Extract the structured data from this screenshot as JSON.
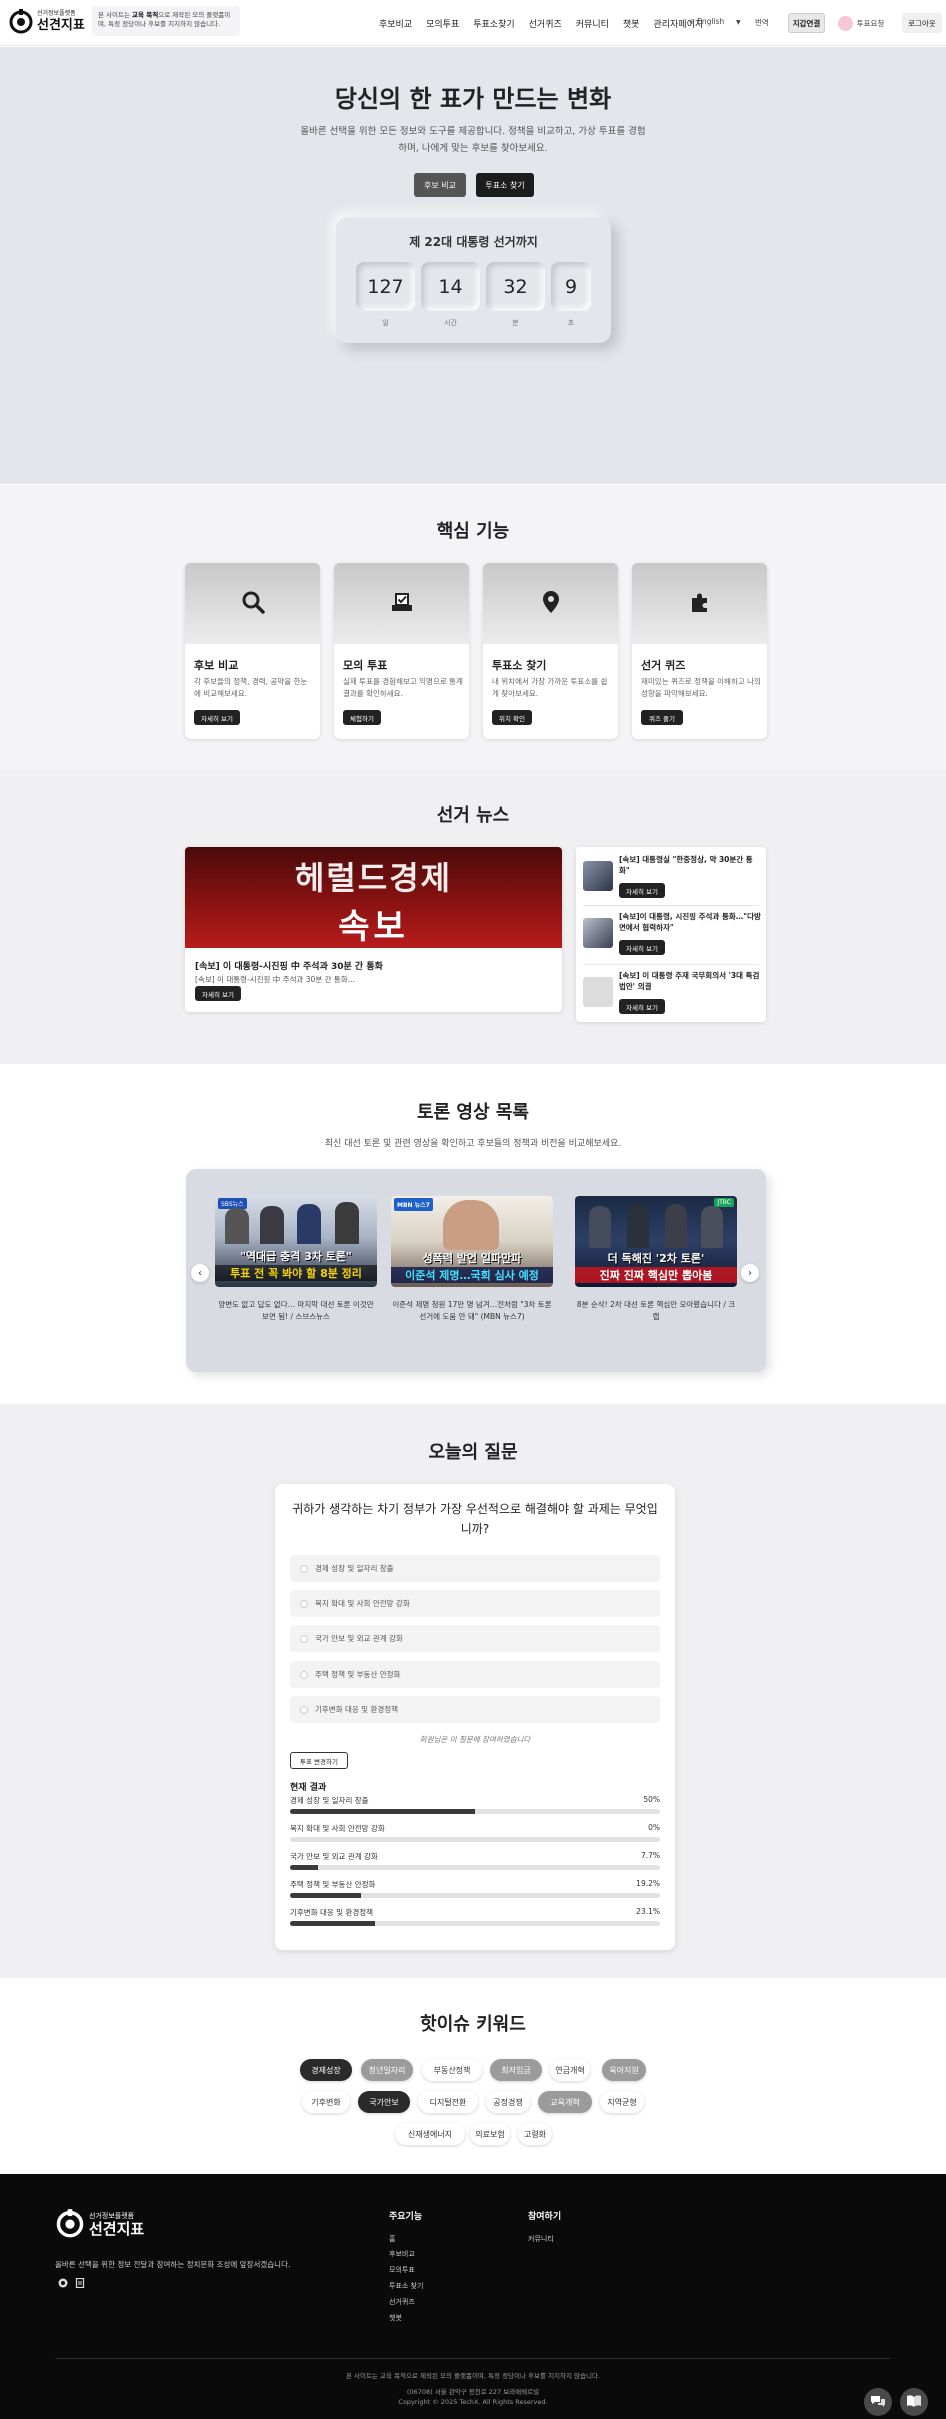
{
  "header": {
    "logo_sub": "선거정보플랫폼",
    "logo_main": "선견지표",
    "notice_pre": "본 사이트는 ",
    "notice_bold": "교육 목적",
    "notice_post": "으로 제작된 모의 플랫폼이며, 특정 정당이나 후보를 지지하지 않습니다.",
    "nav": [
      "후보비교",
      "모의투표",
      "투표소찾기",
      "선거퀴즈",
      "커뮤니티",
      "챗봇",
      "관리자페이지"
    ],
    "lang": "English",
    "translate": "번역",
    "btn_gray": "지갑연결",
    "btn_vote": "투표요청",
    "btn_login": "로그아웃"
  },
  "hero": {
    "title": "당신의 한 표가 만드는 변화",
    "desc": "올바른 선택을 위한 모든 정보와 도구를 제공합니다. 정책을 비교하고, 가상 투표를 경험하며, 나에게 맞는 후보를 찾아보세요.",
    "btn_compare": "후보 비교",
    "btn_find": "투표소 찾기",
    "countdown_title": "제 22대 대통령 선거까지",
    "countdown": [
      {
        "value": "127",
        "label": "일"
      },
      {
        "value": "14",
        "label": "시간"
      },
      {
        "value": "32",
        "label": "분"
      },
      {
        "value": "9",
        "label": "초"
      }
    ]
  },
  "features": {
    "title": "핵심 기능",
    "items": [
      {
        "icon": "search-icon",
        "title": "후보 비교",
        "desc": "각 후보들의 정책, 경력, 공약을 한눈에 비교해보세요.",
        "btn": "자세히 보기"
      },
      {
        "icon": "ballot-check-icon",
        "title": "모의 투표",
        "desc": "실제 투표를 경험해보고 익명으로 통계 결과를 확인하세요.",
        "btn": "체험하기"
      },
      {
        "icon": "map-pin-icon",
        "title": "투표소 찾기",
        "desc": "내 위치에서 가장 가까운 투표소를 쉽게 찾아보세요.",
        "btn": "위치 확인"
      },
      {
        "icon": "puzzle-icon",
        "title": "선거 퀴즈",
        "desc": "재미있는 퀴즈로 정책을 이해하고 나의 성향을 파악해보세요.",
        "btn": "퀴즈 풀기"
      }
    ]
  },
  "news": {
    "title": "선거 뉴스",
    "main": {
      "img_line1": "헤럴드경제",
      "img_line2": "속보",
      "title": "[속보] 이 대통령-시진핑 中 주석과 30분 간 통화",
      "desc": "[속보] 이 대통령-시진핑 中 주석과 30분 간 통화...",
      "btn": "자세히 보기"
    },
    "side": [
      {
        "title": "[속보] 대통령실 \"한중정상, 약 30분간 통화\"",
        "btn": "자세히 보기"
      },
      {
        "title": "[속보]이 대통령, 시진핑 주석과 통화…\"다방면에서 협력하자\"",
        "btn": "자세히 보기"
      },
      {
        "title": "[속보] 이 대통령 주재 국무회의서 '3대 특검 법안' 의결",
        "btn": "자세히 보기"
      }
    ]
  },
  "videos": {
    "title": "토론 영상 목록",
    "desc": "최신 대선 토론 및 관련 영상을 확인하고 후보들의 정책과 비전을 비교해보세요.",
    "items": [
      {
        "tag": "SBS뉴스",
        "line1": "\"역대급 충격 3차 토론\"",
        "line2": "투표 전 꼭 봐야 할 8분 정리",
        "caption": "양변도 없고 답도 없다… 마지막 대선 토론 이것만 보면 됨! / 스브스뉴스"
      },
      {
        "tag": "MBN 뉴스7",
        "line1": "성폭력 발언 일파만파",
        "line2": "이준석 제명…국회 심사 예정",
        "caption": "이준석 제명 청원 17만 명 넘겨…전처럼 \"3차 토론 선거에 도움 안 돼\" (MBN 뉴스7)"
      },
      {
        "tag": "JTBC",
        "line1": "더 독해진 '2차 토론'",
        "line2": "진짜 진짜 핵심만 뽑아봄",
        "caption": "8분 순삭! 2차 대선 토론 핵심만 모아봤습니다 / 크랩"
      }
    ]
  },
  "question": {
    "title": "오늘의 질문",
    "text": "귀하가 생각하는 차기 정부가 가장 우선적으로 해결해야 할 과제는 무엇입니까?",
    "options": [
      "경제 성장 및 일자리 창출",
      "복지 확대 및 사회 안전망 강화",
      "국가 안보 및 외교 관계 강화",
      "주택 정책 및 부동산 안정화",
      "기후변화 대응 및 환경정책"
    ],
    "note": "회원님은 이 질문에 참여하였습니다",
    "change_btn": "투표 변경하기",
    "results_title": "현재 결과",
    "results": [
      {
        "label": "경제 성장 및 일자리 창출",
        "pct": "50%",
        "value": 50
      },
      {
        "label": "복지 확대 및 사회 안전망 강화",
        "pct": "0%",
        "value": 0
      },
      {
        "label": "국가 안보 및 외교 관계 강화",
        "pct": "7.7%",
        "value": 7.7
      },
      {
        "label": "주택 정책 및 부동산 안정화",
        "pct": "19.2%",
        "value": 19.2
      },
      {
        "label": "기후변화 대응 및 환경정책",
        "pct": "23.1%",
        "value": 23.1
      }
    ]
  },
  "keywords": {
    "title": "핫이슈 키워드",
    "rows": [
      [
        {
          "text": "경제성장",
          "level": 0
        },
        {
          "text": "청년일자리",
          "level": 1
        },
        {
          "text": "부동산정책",
          "level": 2
        },
        {
          "text": "최저임금",
          "level": 1
        },
        {
          "text": "연금개혁",
          "level": 2
        },
        {
          "text": "육아지원",
          "level": 1
        }
      ],
      [
        {
          "text": "기후변화",
          "level": 2
        },
        {
          "text": "국가안보",
          "level": 0
        },
        {
          "text": "디지털전환",
          "level": 2
        },
        {
          "text": "공정경쟁",
          "level": 2
        },
        {
          "text": "교육개혁",
          "level": 1
        },
        {
          "text": "지역균형",
          "level": 2
        }
      ],
      [
        {
          "text": "신재생에너지",
          "level": 2
        },
        {
          "text": "의료보험",
          "level": 2
        },
        {
          "text": "고령화",
          "level": 2
        }
      ]
    ]
  },
  "footer": {
    "logo_sub": "선거정보플랫폼",
    "logo_main": "선견지표",
    "desc": "올바른 선택을 위한 정보 전달과 참여하는 정치문화 조성에 앞장서겠습니다.",
    "col1_title": "주요기능",
    "col1_links": [
      "홈",
      "후보비교",
      "모의투표",
      "투표소 찾기",
      "선거퀴즈",
      "챗봇"
    ],
    "col2_title": "참여하기",
    "col2_links": [
      "커뮤니티"
    ],
    "bottom1": "본 사이트는 교육 목적으로 제작된 모의 플랫폼이며, 특정 정당이나 후보를 지지하지 않습니다.",
    "bottom2": "(06708) 서울 관악구 봉천로 227 보라매쉐르빌",
    "bottom3": "Copyright © 2025 TechX. All Rights Reserved."
  }
}
